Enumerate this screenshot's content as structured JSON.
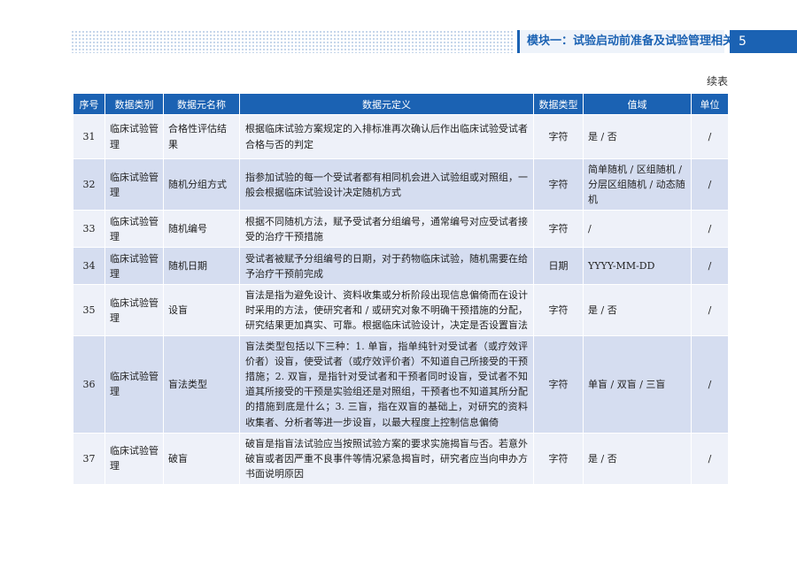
{
  "header": {
    "title": "模块一：试验启动前准备及试验管理相关",
    "page_number": "5"
  },
  "continued_label": "续表",
  "table": {
    "columns": [
      "序号",
      "数据类别",
      "数据元名称",
      "数据元定义",
      "数据类型",
      "值域",
      "单位"
    ],
    "rows": [
      {
        "no": "31",
        "category": "临床试验管理",
        "name": "合格性评估结果",
        "definition": "根据临床试验方案规定的入排标准再次确认后作出临床试验受试者合格与否的判定",
        "type": "字符",
        "range": "是 / 否",
        "unit": "/"
      },
      {
        "no": "32",
        "category": "临床试验管理",
        "name": "随机分组方式",
        "definition": "指参加试验的每一个受试者都有相同机会进入试验组或对照组，一般会根据临床试验设计决定随机方式",
        "type": "字符",
        "range": "简单随机 / 区组随机 / 分层区组随机 / 动态随机",
        "unit": "/"
      },
      {
        "no": "33",
        "category": "临床试验管理",
        "name": "随机编号",
        "definition": "根据不同随机方法，赋予受试者分组编号，通常编号对应受试者接受的治疗干预措施",
        "type": "字符",
        "range": "/",
        "unit": "/"
      },
      {
        "no": "34",
        "category": "临床试验管理",
        "name": "随机日期",
        "definition": "受试者被赋予分组编号的日期，对于药物临床试验，随机需要在给予治疗干预前完成",
        "type": "日期",
        "range": "YYYY-MM-DD",
        "unit": "/"
      },
      {
        "no": "35",
        "category": "临床试验管理",
        "name": "设盲",
        "definition": "盲法是指为避免设计、资料收集或分析阶段出现信息偏倚而在设计时采用的方法，使研究者和 / 或研究对象不明确干预措施的分配，研究结果更加真实、可靠。根据临床试验设计，决定是否设置盲法",
        "type": "字符",
        "range": "是 / 否",
        "unit": "/"
      },
      {
        "no": "36",
        "category": "临床试验管理",
        "name": "盲法类型",
        "definition": "盲法类型包括以下三种：1. 单盲，指单纯针对受试者（或疗效评价者）设盲，使受试者（或疗效评价者）不知道自己所接受的干预措施；2. 双盲，是指针对受试者和干预者同时设盲，受试者不知道其所接受的干预是实验组还是对照组，干预者也不知道其所分配的措施到底是什么；3. 三盲，指在双盲的基础上，对研究的资料收集者、分析者等进一步设盲，以最大程度上控制信息偏倚",
        "type": "字符",
        "range": "单盲 / 双盲 / 三盲",
        "unit": "/"
      },
      {
        "no": "37",
        "category": "临床试验管理",
        "name": "破盲",
        "definition": "破盲是指盲法试验应当按照试验方案的要求实施揭盲与否。若意外破盲或者因严重不良事件等情况紧急揭盲时，研究者应当向申办方书面说明原因",
        "type": "字符",
        "range": "是 / 否",
        "unit": "/"
      }
    ]
  }
}
